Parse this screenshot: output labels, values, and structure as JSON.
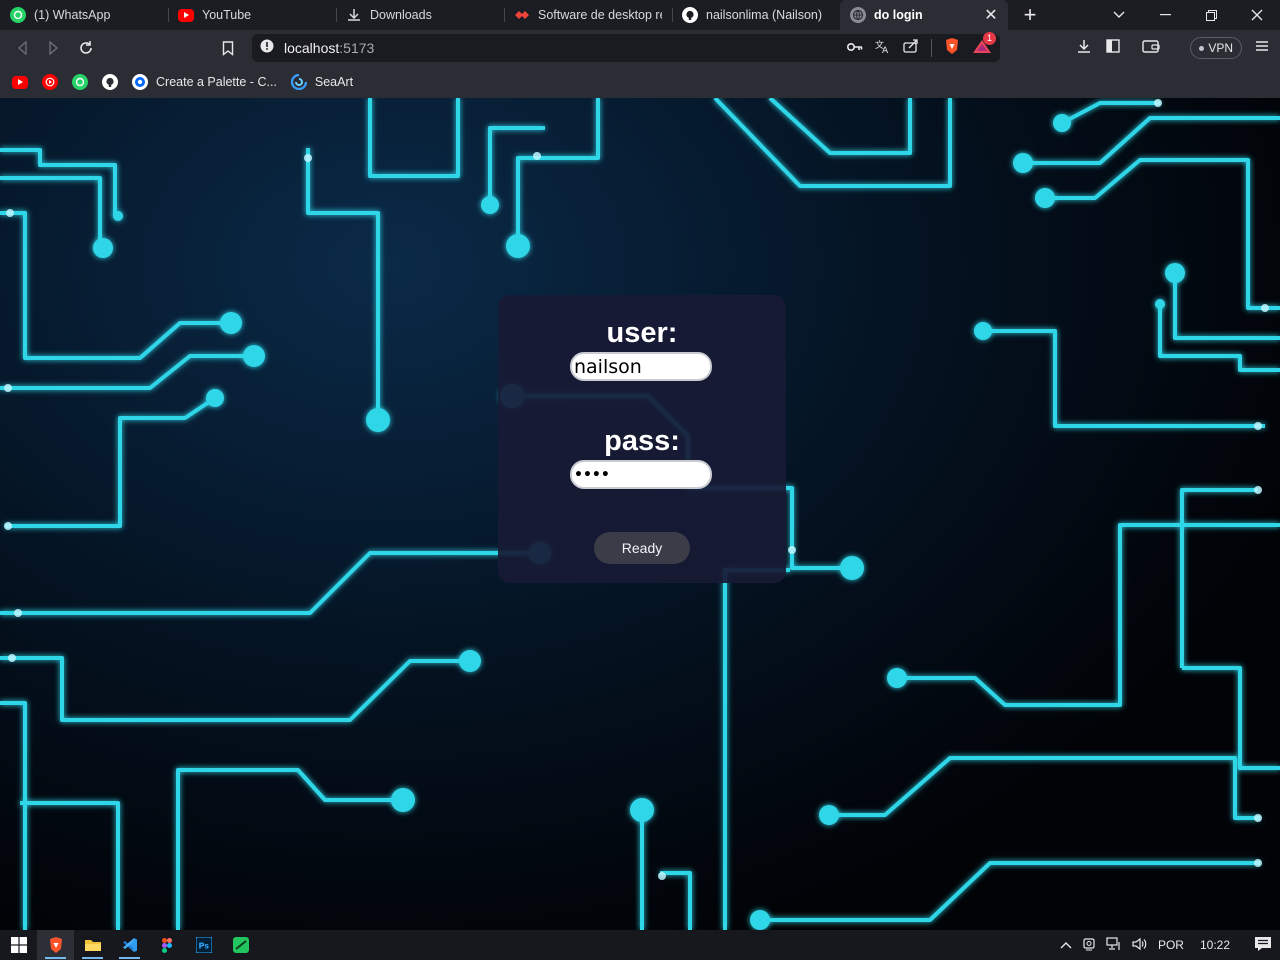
{
  "browser": {
    "tabs": [
      {
        "label": "(1) WhatsApp",
        "icon": "whatsapp-icon"
      },
      {
        "label": "YouTube",
        "icon": "youtube-icon"
      },
      {
        "label": "Downloads",
        "icon": "download-icon"
      },
      {
        "label": "Software de desktop rem",
        "icon": "anydesk-icon"
      },
      {
        "label": "nailsonlima (Nailson)",
        "icon": "github-icon"
      },
      {
        "label": "do login",
        "icon": "globe-icon",
        "active": true
      }
    ],
    "address": {
      "host": "localhost",
      "port": ":5173"
    },
    "brave_badge": "1",
    "vpn_label": "VPN",
    "bookmarks": [
      {
        "label": "",
        "icon": "youtube-icon"
      },
      {
        "label": "",
        "icon": "youtube-music-icon"
      },
      {
        "label": "",
        "icon": "whatsapp-icon"
      },
      {
        "label": "",
        "icon": "github-icon"
      },
      {
        "label": "Create a Palette - C...",
        "icon": "coolors-icon"
      },
      {
        "label": "SeaArt",
        "icon": "seaart-icon"
      }
    ]
  },
  "login": {
    "user_label": "user:",
    "user_value": "nailson",
    "pass_label": "pass:",
    "pass_value": "••••",
    "submit_label": "Ready"
  },
  "taskbar": {
    "apps": [
      "brave-icon",
      "file-explorer-icon",
      "vscode-icon",
      "figma-icon",
      "photoshop-icon",
      "app-green-icon"
    ],
    "language": "POR",
    "time": "10:22"
  },
  "colors": {
    "circuit": "#2fd6e8",
    "card": "#181a34",
    "button": "#3a3d47"
  }
}
